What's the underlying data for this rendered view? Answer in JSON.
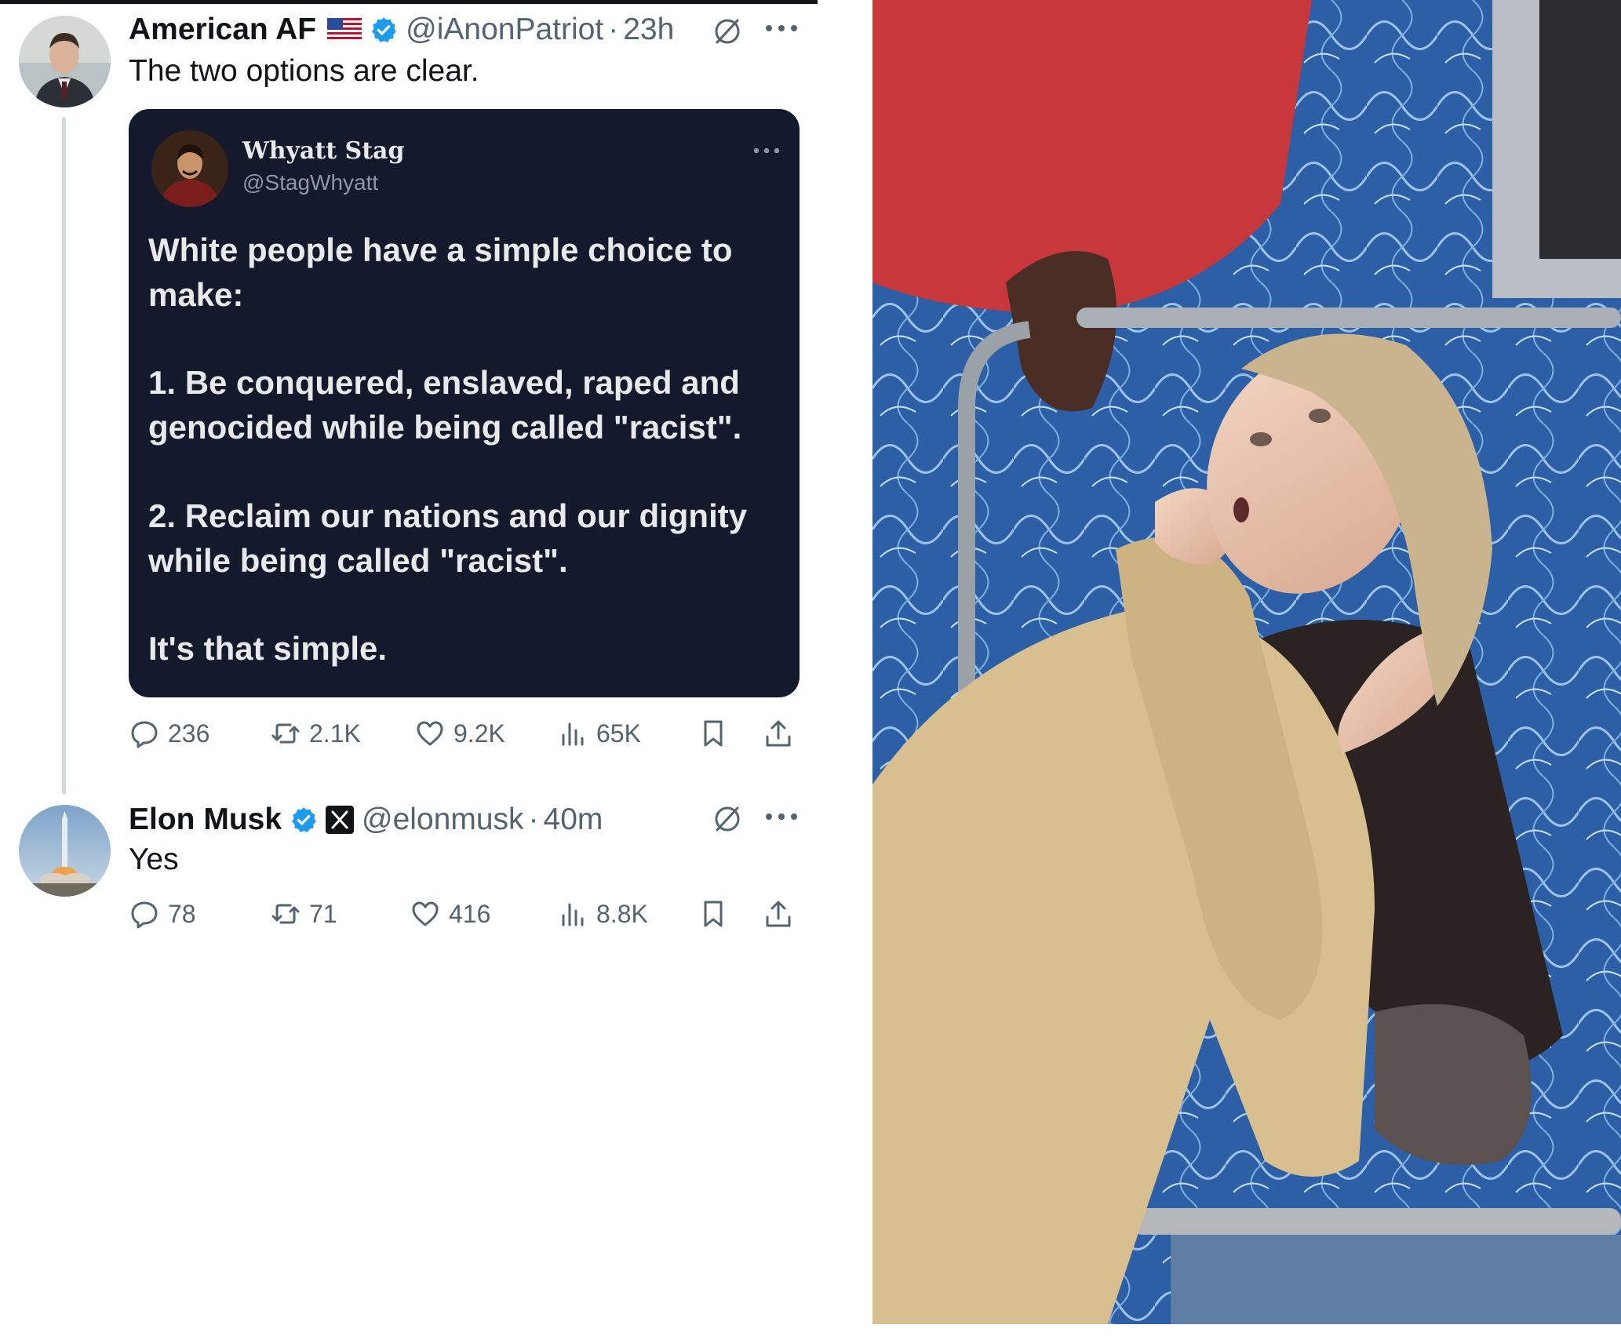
{
  "tweet1": {
    "display_name": "American AF",
    "handle": "@iAnonPatriot",
    "separator": "·",
    "time": "23h",
    "text": "The two options are clear.",
    "metrics": {
      "replies": "236",
      "reposts": "2.1K",
      "likes": "9.2K",
      "views": "65K"
    }
  },
  "quote": {
    "display_name": "Whyatt Stag",
    "handle": "@StagWhyatt",
    "p1": "White people have a simple choice to make:",
    "p2": "1. Be conquered, enslaved, raped and genocided while being called \"racist\".",
    "p3": "2. Reclaim our nations and our dignity while being called \"racist\".",
    "p4": "It's that simple."
  },
  "tweet2": {
    "display_name": "Elon Musk",
    "handle": "@elonmusk",
    "separator": "·",
    "time": "40m",
    "text": "Yes",
    "metrics": {
      "replies": "78",
      "reposts": "71",
      "likes": "416",
      "views": "8.8K"
    }
  },
  "colors": {
    "text_primary": "#0f1419",
    "text_secondary": "#536471",
    "verified_blue": "#1d9bf0",
    "quote_card_bg": "#141a2c",
    "thread_line": "#cfd9de"
  },
  "icons": [
    "us-flag-icon",
    "verified-badge-icon",
    "x-logo-icon",
    "grok-icon",
    "more-icon",
    "reply-icon",
    "repost-icon",
    "like-icon",
    "views-icon",
    "bookmark-icon",
    "share-icon"
  ]
}
